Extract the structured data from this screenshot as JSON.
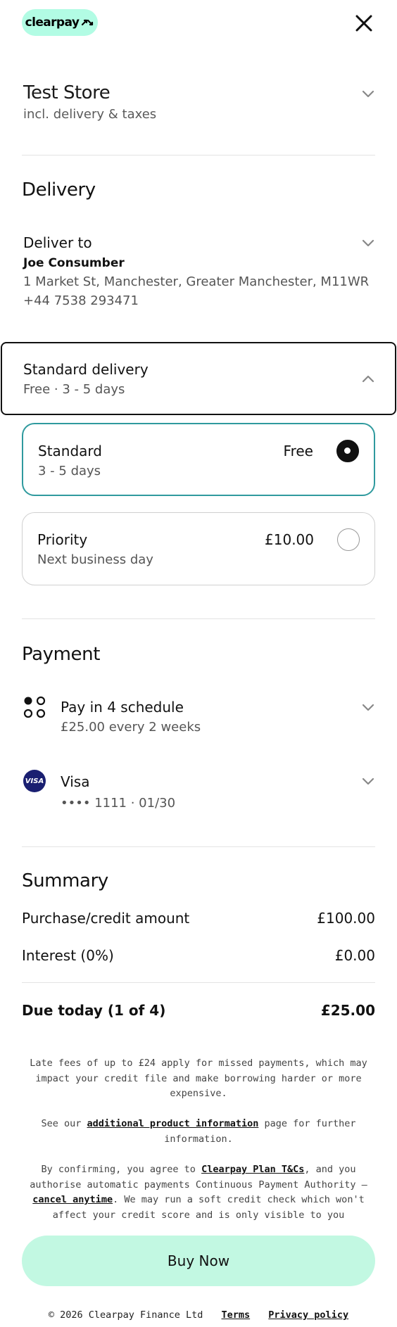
{
  "header": {
    "logo_text": "clearpay",
    "logo_icon": "clearpay-arrows-icon",
    "close_icon": "close-icon"
  },
  "store": {
    "title": "Test Store",
    "subtitle": "incl. delivery & taxes"
  },
  "delivery": {
    "section_title": "Delivery",
    "deliver_to_label": "Deliver to",
    "name": "Joe Consumber",
    "address": "1 Market St, Manchester, Greater Manchester, M11WR",
    "phone": "+44 7538 293471",
    "method_title": "Standard delivery",
    "method_summary": "Free · 3 - 5 days",
    "options": [
      {
        "title": "Standard",
        "subtitle": "3 - 5 days",
        "price": "Free",
        "selected": true
      },
      {
        "title": "Priority",
        "subtitle": "Next business day",
        "price": "£10.00",
        "selected": false
      }
    ]
  },
  "payment": {
    "section_title": "Payment",
    "schedule_title": "Pay in 4 schedule",
    "schedule_sub": "£25.00 every 2 weeks",
    "card_brand": "Visa",
    "card_badge": "VISA",
    "card_detail": "•••• 1111 · 01/30"
  },
  "summary": {
    "section_title": "Summary",
    "rows": [
      {
        "label": "Purchase/credit amount",
        "value": "£100.00"
      },
      {
        "label": "Interest (0%)",
        "value": "£0.00"
      }
    ],
    "due_label": "Due today (1 of 4)",
    "due_value": "£25.00"
  },
  "legal": {
    "late_fees": "Late fees of up to £24 apply for missed payments, which may impact your credit file and make borrowing harder or more expensive.",
    "see_our": "See our",
    "product_info_link": "additional product information",
    "further_info": "page for further information.",
    "confirm_1": "By confirming, you agree to",
    "plan_link": "Clearpay Plan T&Cs",
    "confirm_2": ", and you authorise automatic payments Continuous Payment Authority —",
    "cancel_link": "cancel anytime",
    "confirm_3": ". We may run a soft credit check which won't affect your credit score and is only visible to you"
  },
  "cta": {
    "buy_label": "Buy Now"
  },
  "footer": {
    "copyright": "© 2026 Clearpay Finance Ltd",
    "terms": "Terms",
    "privacy": "Privacy policy"
  },
  "colors": {
    "brand_mint": "#b2fce4",
    "selected_border": "#2f9a9e",
    "visa_blue": "#1a1f71"
  }
}
